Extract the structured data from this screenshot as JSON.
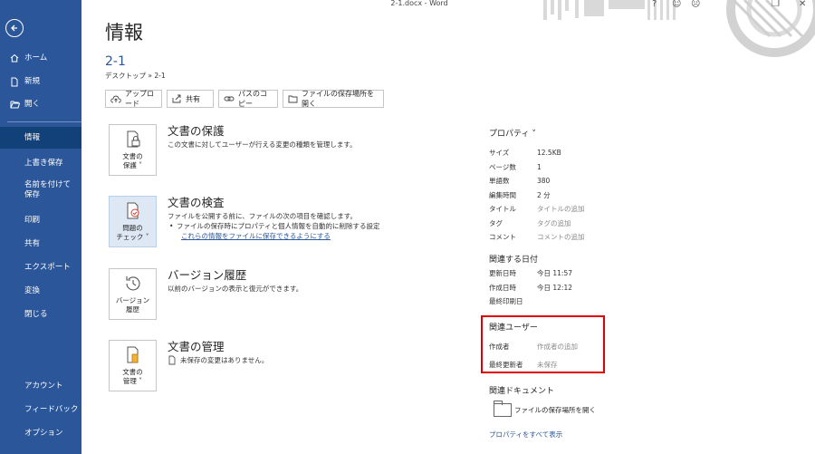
{
  "window": {
    "title": "2-1.docx - Word"
  },
  "sidebar": {
    "items": [
      {
        "label": "ホーム",
        "icon": "home-icon"
      },
      {
        "label": "新規",
        "icon": "new-document-icon"
      },
      {
        "label": "開く",
        "icon": "open-folder-icon"
      },
      {
        "label": "情報",
        "selected": true
      },
      {
        "label": "上書き保存"
      },
      {
        "label": "名前を付けて保存"
      },
      {
        "label": "印刷"
      },
      {
        "label": "共有"
      },
      {
        "label": "エクスポート"
      },
      {
        "label": "変換"
      },
      {
        "label": "閉じる"
      }
    ],
    "bottom": [
      {
        "label": "アカウント"
      },
      {
        "label": "フィードバック"
      },
      {
        "label": "オプション"
      }
    ]
  },
  "main": {
    "title": "情報",
    "doc_name": "2-1",
    "doc_path": "デスクトップ » 2-1",
    "actions": [
      {
        "label": "アップロード",
        "icon": "upload-icon"
      },
      {
        "label": "共有",
        "icon": "share-icon"
      },
      {
        "label": "パスのコピー",
        "icon": "link-icon"
      },
      {
        "label": "ファイルの保存場所を開く",
        "icon": "folder-icon"
      }
    ],
    "sections": {
      "protect": {
        "button": "文書の\n保護 ˅",
        "title": "文書の保護",
        "desc": "この文書に対してユーザーが行える変更の種類を管理します。"
      },
      "inspect": {
        "button": "問題の\nチェック ˅",
        "title": "文書の検査",
        "desc": "ファイルを公開する前に、ファイルの次の項目を確認します。",
        "bullet": "ファイルの保存時にプロパティと個人情報を自動的に削除する設定",
        "link": "これらの情報をファイルに保存できるようにする"
      },
      "versions": {
        "button": "バージョン\n履歴",
        "title": "バージョン履歴",
        "desc": "以前のバージョンの表示と復元ができます。"
      },
      "manage": {
        "button": "文書の\n管理 ˅",
        "title": "文書の管理",
        "desc": "未保存の変更はありません。"
      }
    }
  },
  "properties": {
    "heading": "プロパティ ˅",
    "rows": [
      {
        "key": "サイズ",
        "value": "12.5KB"
      },
      {
        "key": "ページ数",
        "value": "1"
      },
      {
        "key": "単語数",
        "value": "380"
      },
      {
        "key": "編集時間",
        "value": "2 分"
      },
      {
        "key": "タイトル",
        "value": "タイトルの追加",
        "muted": true
      },
      {
        "key": "タグ",
        "value": "タグの追加",
        "muted": true
      },
      {
        "key": "コメント",
        "value": "コメントの追加",
        "muted": true
      }
    ],
    "dates_heading": "関連する日付",
    "dates": [
      {
        "key": "更新日時",
        "value": "今日 11:57"
      },
      {
        "key": "作成日時",
        "value": "今日 12:12"
      },
      {
        "key": "最終印刷日",
        "value": ""
      }
    ],
    "people_heading": "関連ユーザー",
    "people": [
      {
        "key": "作成者",
        "value": "作成者の追加",
        "muted": true
      },
      {
        "key": "最終更新者",
        "value": "未保存",
        "muted": true
      }
    ],
    "docs_heading": "関連ドキュメント",
    "open_location": "ファイルの保存場所を開く",
    "show_all": "プロパティをすべて表示"
  },
  "colors": {
    "sidebar": "#2b579a",
    "sidebar_selected": "#124078",
    "accent": "#2b579a",
    "highlight": "#e00000"
  }
}
